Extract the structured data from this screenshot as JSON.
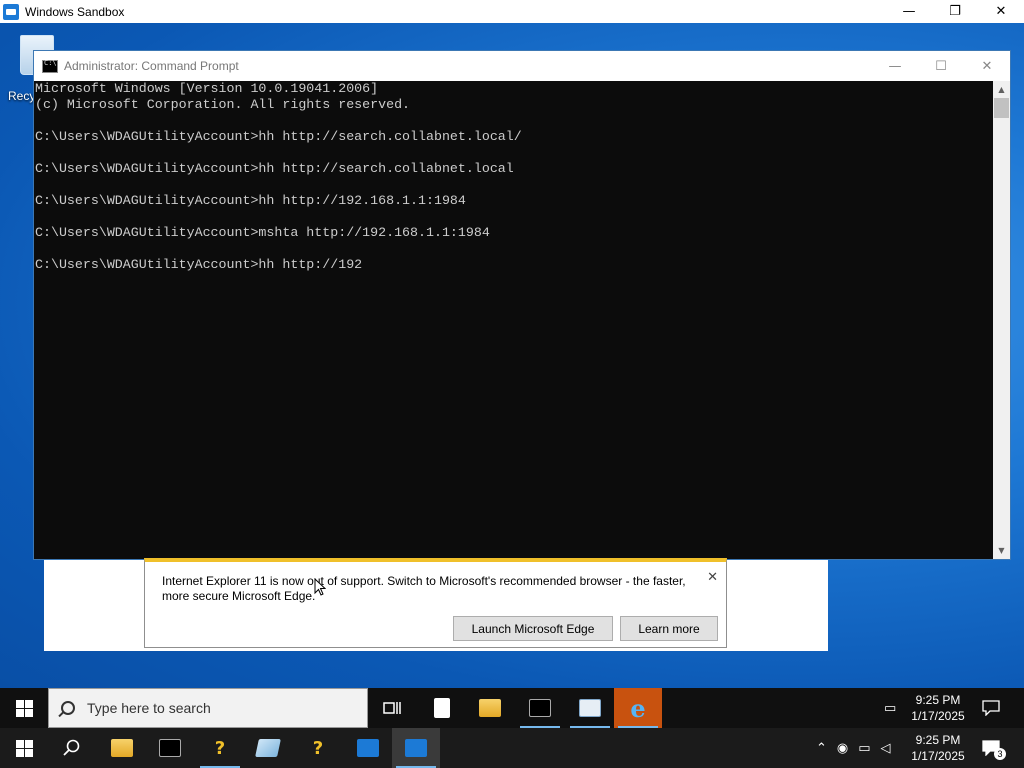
{
  "host_window": {
    "title": "Windows Sandbox",
    "controls": {
      "minimize": "—",
      "maximize": "❐",
      "close": "✕"
    }
  },
  "desktop": {
    "recycle_bin_label": "Recy"
  },
  "cmd_window": {
    "title": "Administrator: Command Prompt",
    "controls": {
      "minimize": "—",
      "maximize": "☐",
      "close": "✕"
    },
    "lines": [
      "Microsoft Windows [Version 10.0.19041.2006]",
      "(c) Microsoft Corporation. All rights reserved.",
      "",
      "C:\\Users\\WDAGUtilityAccount>hh http://search.collabnet.local/",
      "",
      "C:\\Users\\WDAGUtilityAccount>hh http://search.collabnet.local",
      "",
      "C:\\Users\\WDAGUtilityAccount>hh http://192.168.1.1:1984",
      "",
      "C:\\Users\\WDAGUtilityAccount>mshta http://192.168.1.1:1984",
      "",
      "C:\\Users\\WDAGUtilityAccount>hh http://192"
    ],
    "scroll_up_icon": "arrow-up",
    "scroll_down_icon": "arrow-down"
  },
  "ie_notice": {
    "message": "Internet Explorer 11 is now out of support. Switch to Microsoft's recommended browser - the faster, more secure Microsoft Edge.",
    "close_label": "✕",
    "launch_edge_label": "Launch Microsoft Edge",
    "learn_more_label": "Learn more",
    "accent_color": "#f0c02a"
  },
  "taskbar_sandbox": {
    "search_placeholder": "Type here to search",
    "pinned": [
      "task-view-icon",
      "document-icon",
      "file-explorer-icon",
      "command-prompt-icon",
      "notepad-icon",
      "internet-explorer-icon"
    ],
    "time": "9:25 PM",
    "date": "1/17/2025"
  },
  "taskbar_host": {
    "pinned": [
      "search-icon",
      "file-explorer-icon",
      "command-prompt-icon",
      "help-tool-icon",
      "edit-tool-icon",
      "help-tool-icon",
      "sandbox-icon",
      "sandbox-icon"
    ],
    "time": "9:25 PM",
    "date": "1/17/2025",
    "notification_count": "3"
  }
}
